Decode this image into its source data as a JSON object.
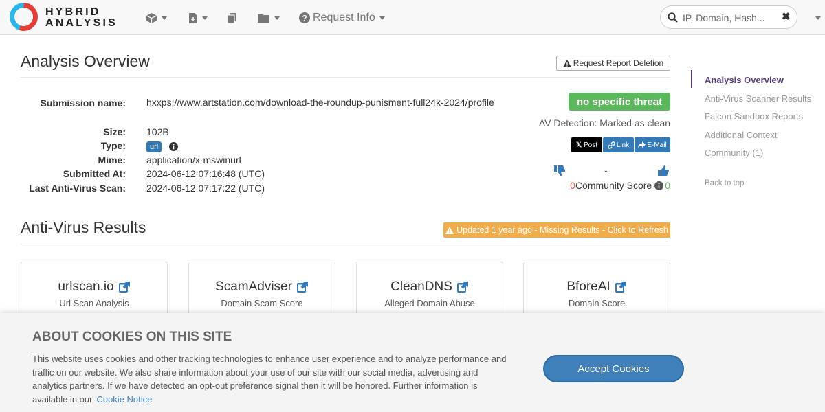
{
  "navbar": {
    "logo_line1": "HYBRID",
    "logo_line2": "ANALYSIS",
    "request_info_label": "Request Info",
    "search_placeholder": "IP, Domain, Hash...",
    "clear_symbol": "✖"
  },
  "overview": {
    "title": "Analysis Overview",
    "deletion_label": "Request Report Deletion",
    "labels": {
      "submission_name": "Submission name:",
      "size": "Size:",
      "type": "Type:",
      "mime": "Mime:",
      "submitted_at": "Submitted At:",
      "last_av_scan": "Last Anti-Virus Scan:"
    },
    "values": {
      "submission_name": "hxxps://www.artstation.com/download-the-roundup-punisment-full24k-2024/profile",
      "size": "102B",
      "type": "url",
      "mime": "application/x-mswinurl",
      "submitted_at": "2024-06-12 07:16:48 (UTC)",
      "last_av_scan": "2024-06-12 07:17:22 (UTC)"
    },
    "verdict": "no specific threat",
    "av_detection": "AV Detection: Marked as clean",
    "share": {
      "post": "Post",
      "link": "Link",
      "email": "E-Mail"
    },
    "vote_dash": "-",
    "community": {
      "negative": "0",
      "label": "Community Score",
      "positive": "0"
    }
  },
  "av_results": {
    "title": "Anti-Virus Results",
    "refresh_label": "Updated 1 year ago - Missing Results - Click to Refresh",
    "cards": [
      {
        "title": "urlscan.io",
        "subtitle": "Url Scan Analysis"
      },
      {
        "title": "ScamAdviser",
        "subtitle": "Domain Scam Score"
      },
      {
        "title": "CleanDNS",
        "subtitle": "Alleged Domain Abuse"
      },
      {
        "title": "BforeAI",
        "subtitle": "Domain Score"
      }
    ]
  },
  "sidebar": {
    "items": [
      {
        "label": "Analysis Overview"
      },
      {
        "label": "Anti-Virus Scanner Results"
      },
      {
        "label": "Falcon Sandbox Reports"
      },
      {
        "label": "Additional Context"
      },
      {
        "label": "Community (1)"
      }
    ],
    "back_to_top": "Back to top"
  },
  "cookie": {
    "title": "ABOUT COOKIES ON THIS SITE",
    "text": "This website uses cookies and other tracking technologies to enhance user experience and to analyze performance and traffic on our website. We also share information about your use of our site with our social media, advertising and analytics partners. If we have detected an opt-out preference signal then it will be honored. Further information is available in our",
    "link": "Cookie Notice",
    "accept": "Accept Cookies"
  },
  "colors": {
    "verdict_green": "#5cb85c",
    "primary_blue": "#337ab7",
    "warning_orange": "#f0ad4e",
    "sidebar_active": "#563d7c",
    "negative_red": "#d9534f"
  }
}
